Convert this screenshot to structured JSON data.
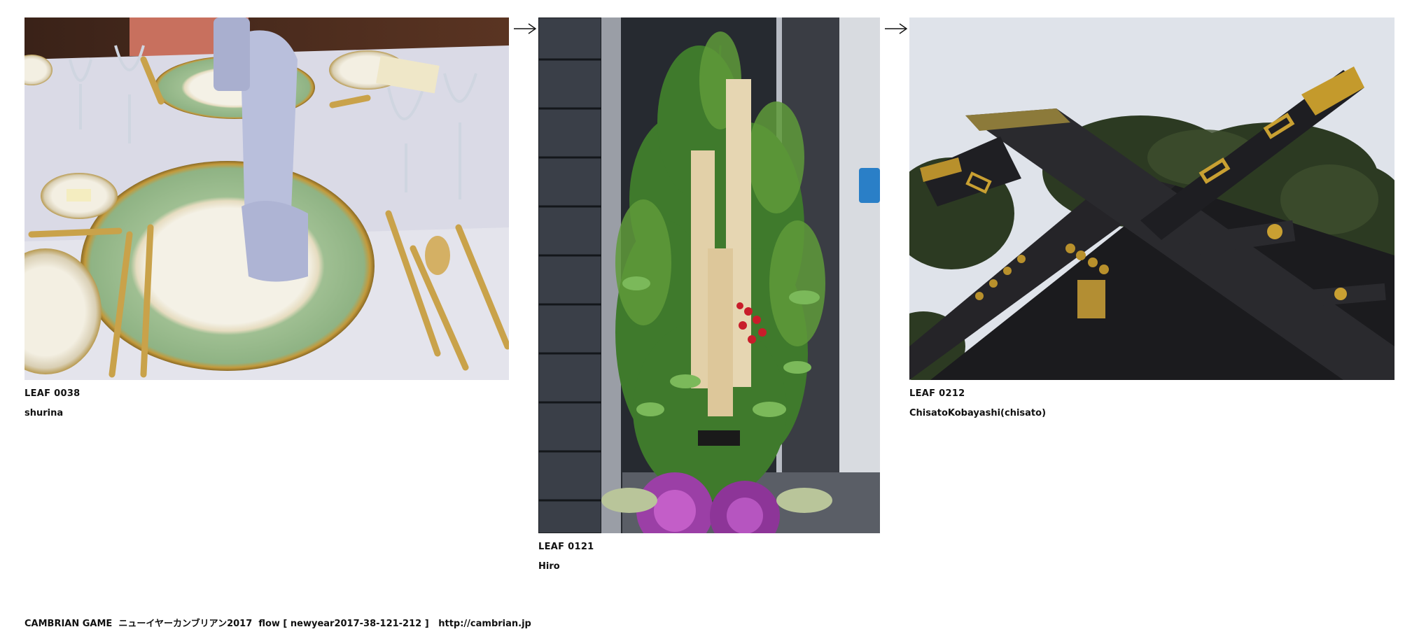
{
  "leaves": [
    {
      "id": "LEAF 0038",
      "author": "shurina",
      "image": "table-setting-photo"
    },
    {
      "id": "LEAF 0121",
      "author": "Hiro",
      "image": "kadomatsu-photo"
    },
    {
      "id": "LEAF 0212",
      "author": "ChisatoKobayashi(chisato)",
      "image": "shrine-roof-photo"
    }
  ],
  "footer": {
    "site": "CAMBRIAN GAME",
    "event": "ニューイヤーカンブリアン2017",
    "flow": "flow [ newyear2017-38-121-212 ]",
    "url": "http://cambrian.jp"
  },
  "icons": {
    "flow_arrow": "right-arrow-icon"
  },
  "colors": {
    "text": "#111111",
    "background": "#ffffff"
  }
}
